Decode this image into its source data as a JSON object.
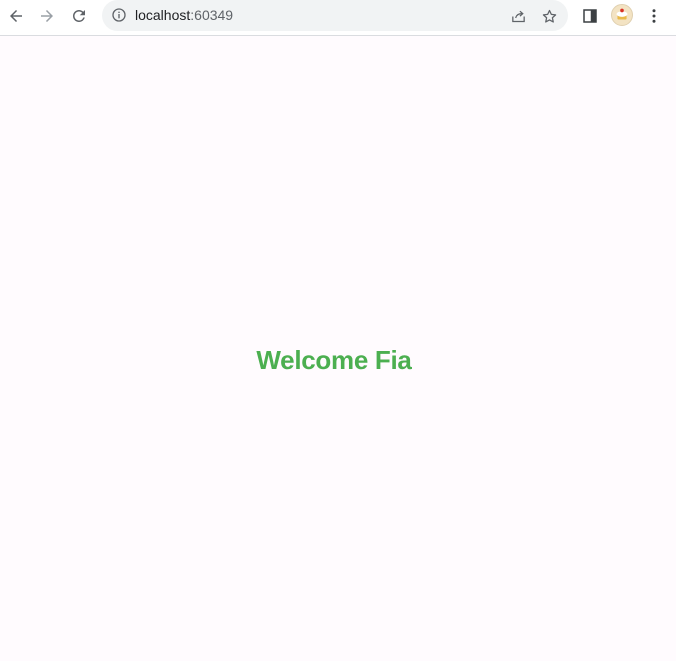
{
  "browser": {
    "url_host": "localhost",
    "url_port": ":60349",
    "icons": {
      "back": "arrow-left-icon",
      "forward": "arrow-right-icon",
      "reload": "reload-icon",
      "info": "info-icon",
      "share": "share-icon",
      "bookmark": "star-icon",
      "side_panel": "side-panel-icon",
      "profile": "avatar",
      "menu": "kebab-menu-icon"
    },
    "forward_enabled": false
  },
  "page": {
    "welcome_text": "Welcome Fia",
    "colors": {
      "background": "#fffbfe",
      "welcome_text": "#4caf50"
    }
  }
}
